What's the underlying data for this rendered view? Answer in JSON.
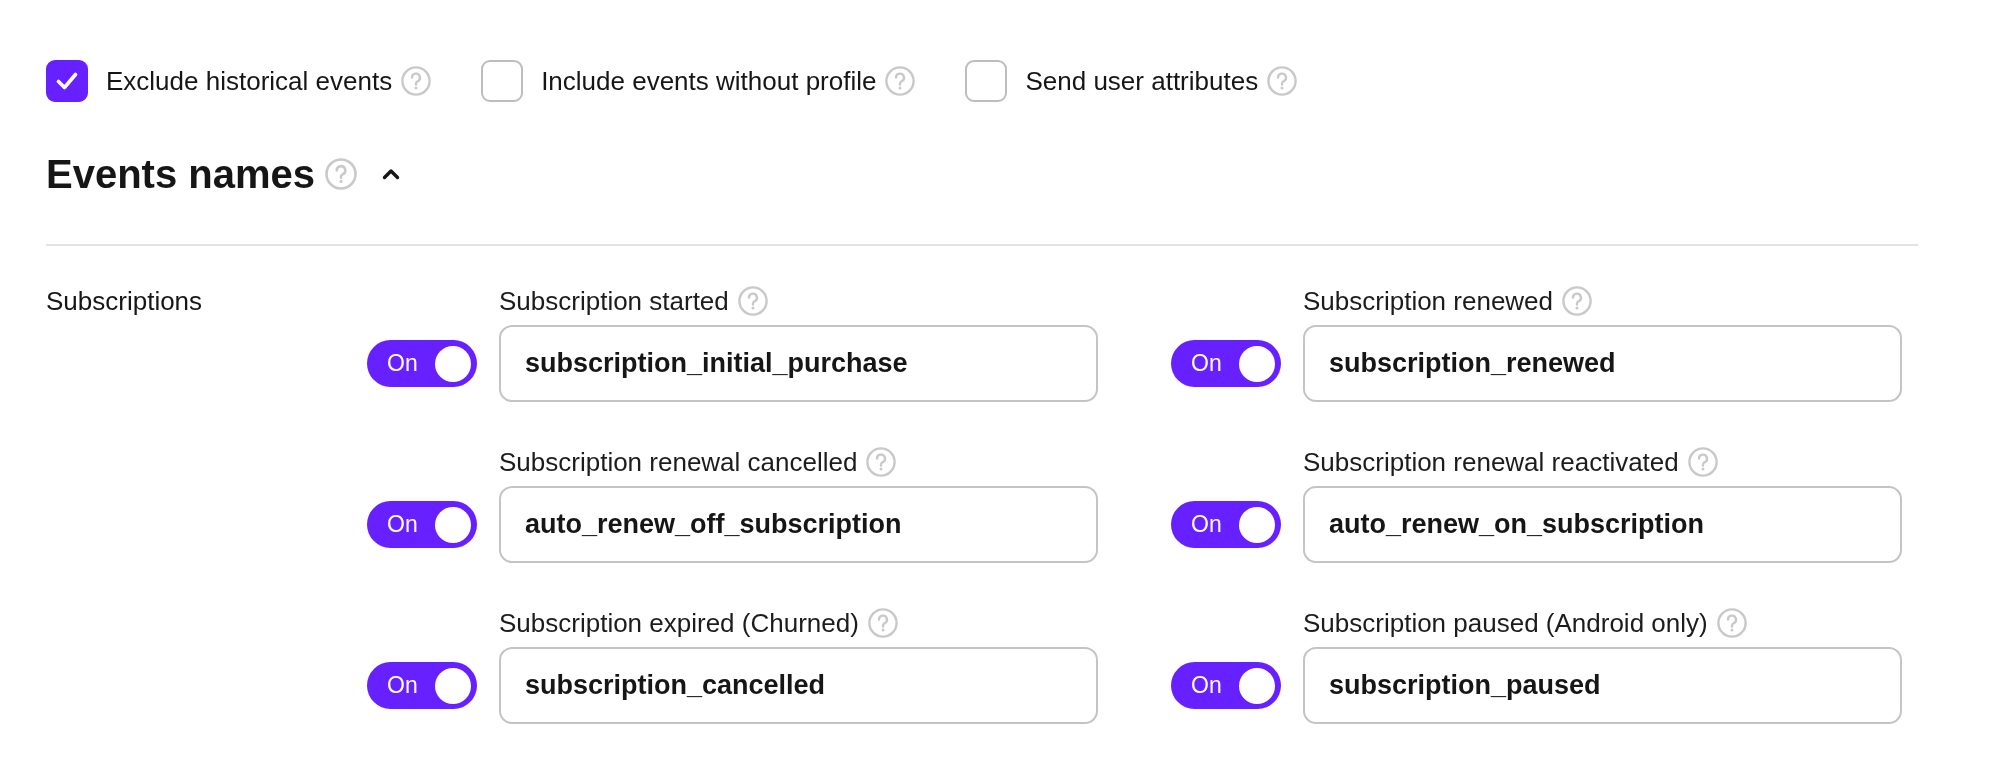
{
  "options": [
    {
      "label": "Exclude historical events",
      "checked": true
    },
    {
      "label": "Include events without profile",
      "checked": false
    },
    {
      "label": "Send user attributes",
      "checked": false
    }
  ],
  "section": {
    "title": "Events names",
    "expanded": true
  },
  "groups": [
    {
      "label": "Subscriptions",
      "events": [
        {
          "label": "Subscription started",
          "on": true,
          "toggle_label": "On",
          "value": "subscription_initial_purchase"
        },
        {
          "label": "Subscription renewed",
          "on": true,
          "toggle_label": "On",
          "value": "subscription_renewed"
        },
        {
          "label": "Subscription renewal cancelled",
          "on": true,
          "toggle_label": "On",
          "value": "auto_renew_off_subscription"
        },
        {
          "label": "Subscription renewal reactivated",
          "on": true,
          "toggle_label": "On",
          "value": "auto_renew_on_subscription"
        },
        {
          "label": "Subscription expired (Churned)",
          "on": true,
          "toggle_label": "On",
          "value": "subscription_cancelled"
        },
        {
          "label": "Subscription paused (Android only)",
          "on": true,
          "toggle_label": "On",
          "value": "subscription_paused"
        }
      ]
    }
  ]
}
